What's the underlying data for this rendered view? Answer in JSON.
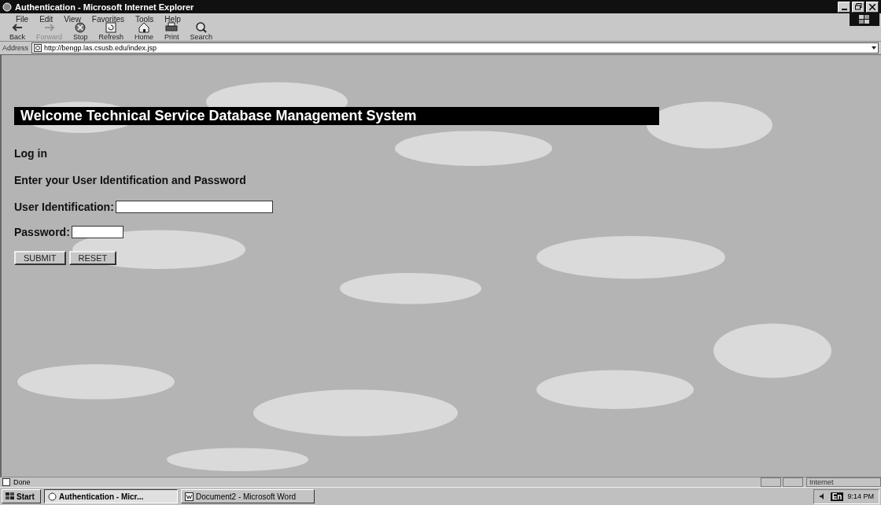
{
  "window": {
    "title": "Authentication - Microsoft Internet Explorer"
  },
  "menu": [
    "File",
    "Edit",
    "View",
    "Favorites",
    "Tools",
    "Help"
  ],
  "toolbar": [
    {
      "label": "Back",
      "kind": "back",
      "disabled": false
    },
    {
      "label": "Forward",
      "kind": "forward",
      "disabled": true
    },
    {
      "label": "Stop",
      "kind": "stop",
      "disabled": false
    },
    {
      "label": "Refresh",
      "kind": "refresh",
      "disabled": false
    },
    {
      "label": "Home",
      "kind": "home",
      "disabled": false
    },
    {
      "label": "Print",
      "kind": "print",
      "disabled": false
    },
    {
      "label": "Search",
      "kind": "search",
      "disabled": false
    }
  ],
  "address": {
    "label": "Address",
    "value": "http://bengp.las.csusb.edu/index.jsp"
  },
  "page": {
    "banner": "Welcome Technical Service Database Management System",
    "heading": "Log in",
    "instruction": "Enter your User Identification and Password",
    "fields": [
      {
        "label": "User Identification:",
        "kind": "wide"
      },
      {
        "label": "Password:",
        "kind": "narrow"
      }
    ],
    "buttons": [
      "SUBMIT",
      "RESET"
    ]
  },
  "status_bar": {
    "text": "Done",
    "zone": "Internet"
  },
  "taskbar": {
    "start": "Start",
    "tasks": [
      {
        "label": "Authentication - Micr...",
        "selected": true,
        "kind": "browser"
      },
      {
        "label": "Document2 - Microsoft Word",
        "selected": false,
        "kind": "word"
      }
    ],
    "language": "En",
    "clock": "9:14 PM"
  }
}
